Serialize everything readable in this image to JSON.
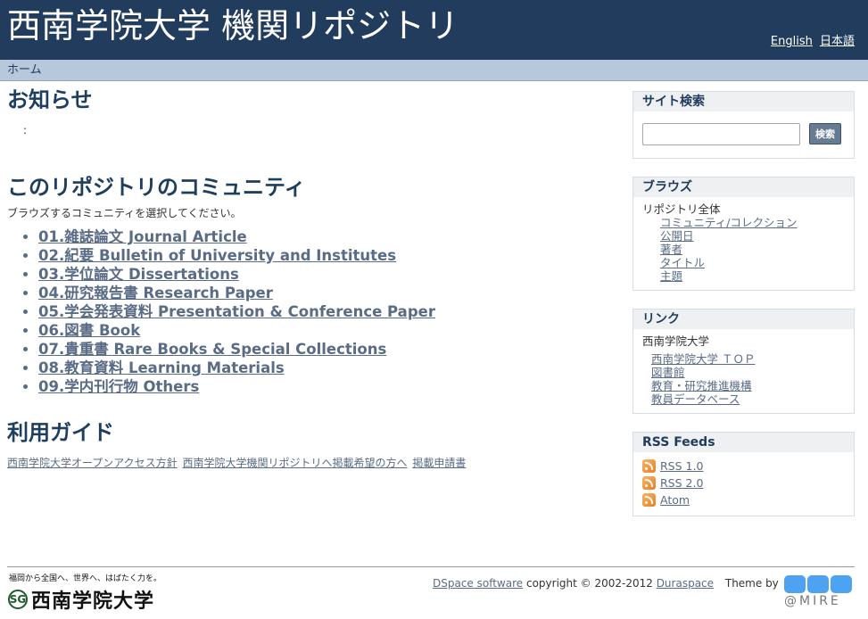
{
  "header": {
    "title": "西南学院大学 機関リポジトリ",
    "lang_english": "English",
    "lang_japanese": "日本語"
  },
  "trail": {
    "home": "ホーム"
  },
  "news": {
    "heading": "お知らせ",
    "body": ":"
  },
  "communities": {
    "heading": "このリポジトリのコミュニティ",
    "intro": "ブラウズするコミュニティを選択してください。",
    "items": [
      "01.雑誌論文 Journal Article",
      "02.紀要 Bulletin of University and Institutes",
      "03.学位論文 Dissertations",
      "04.研究報告書 Research Paper",
      "05.学会発表資料 Presentation & Conference Paper",
      "06.図書 Book",
      "07.貴重書 Rare Books & Special Collections",
      "08.教育資料 Learning Materials",
      "09.学内刊行物 Others"
    ]
  },
  "guide": {
    "heading": "利用ガイド",
    "links": [
      "西南学院大学オープンアクセス方針",
      "西南学院大学機関リポジトリへ掲載希望の方へ",
      "掲載申請書"
    ]
  },
  "sidebar": {
    "search": {
      "heading": "サイト検索",
      "value": "",
      "button": "検索"
    },
    "browse": {
      "heading": "ブラウズ",
      "root": "リポジトリ全体",
      "items": [
        "コミュニティ/コレクション",
        "公開日",
        "著者",
        "タイトル",
        "主題"
      ]
    },
    "links": {
      "heading": "リンク",
      "title": "西南学院大学",
      "items": [
        "西南学院大学 ＴＯＰ",
        "図書館",
        "教育・研究推進機構",
        "教員データベース"
      ]
    },
    "rss": {
      "heading": "RSS Feeds",
      "items": [
        "RSS 1.0",
        "RSS 2.0",
        "Atom"
      ]
    }
  },
  "footer": {
    "tagline": "福岡から全国へ、世界へ、はばたく力を。",
    "brand_mark": "SG",
    "brand_name": "西南学院大学",
    "dspace_link": "DSpace software",
    "copyright": " copyright © 2002-2012 ",
    "duraspace_link": "Duraspace",
    "theme_by": "Theme by",
    "mire_text": "@MIRE"
  },
  "colors": {
    "header_bg": "#213c5c",
    "trail_bg": "#b8c8dc",
    "link": "#5a6c85",
    "heading": "#1e3e5f",
    "rss_orange": "#ec7d1e",
    "mire_blue": "#4da3f2"
  }
}
